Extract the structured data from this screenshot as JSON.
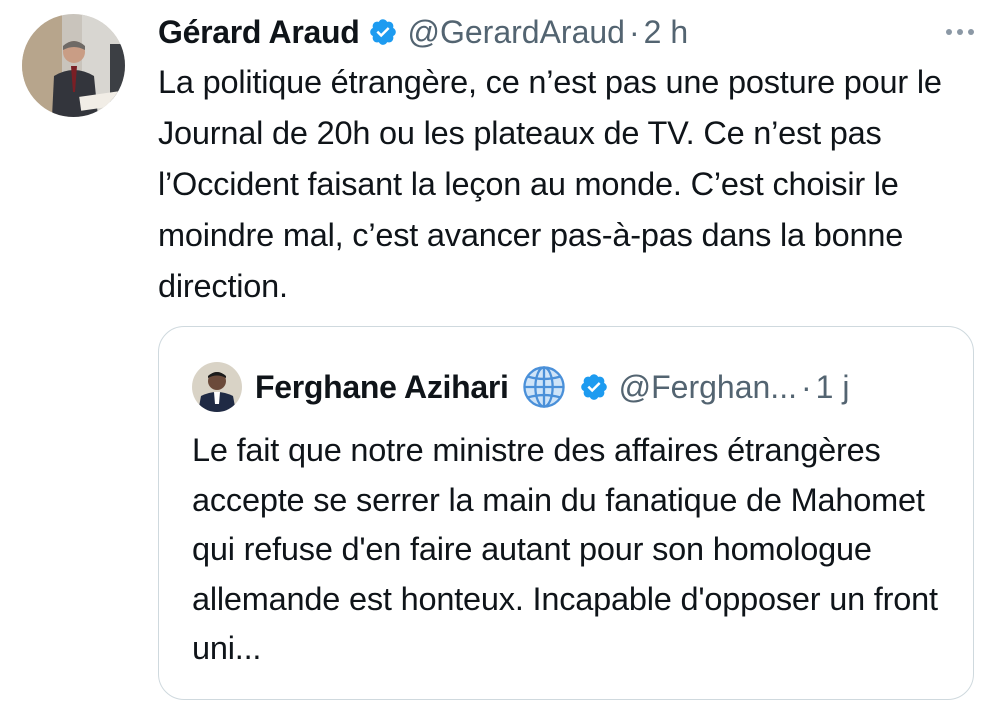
{
  "tweet": {
    "author_name": "Gérard Araud",
    "handle": "@GerardAraud",
    "separator": "·",
    "time": "2 h",
    "avatar_icon": "profile-photo",
    "verified_icon": "verified-badge-icon",
    "more_icon": "more-options-icon",
    "text": "La politique étrangère, ce n’est pas une posture pour le Journal de 20h ou les plateaux de TV. Ce n’est pas l’Occident faisant la leçon au monde. C’est choisir le moindre mal, c’est avancer pas-à-pas dans la bonne direction."
  },
  "quoted": {
    "author_name": "Ferghane Azihari",
    "name_emoji": "🌐",
    "handle": "@Ferghan...",
    "separator": "·",
    "time": "1 j",
    "text": "Le fait que notre ministre des affaires étrangères accepte se serrer la main du fanatique de Mahomet qui refuse d'en faire autant pour son homologue allemande est honteux. Incapable d'opposer un front uni..."
  },
  "colors": {
    "text": "#0f1419",
    "secondary": "#536471",
    "verified": "#1d9bf0",
    "border": "#cfd9de"
  }
}
